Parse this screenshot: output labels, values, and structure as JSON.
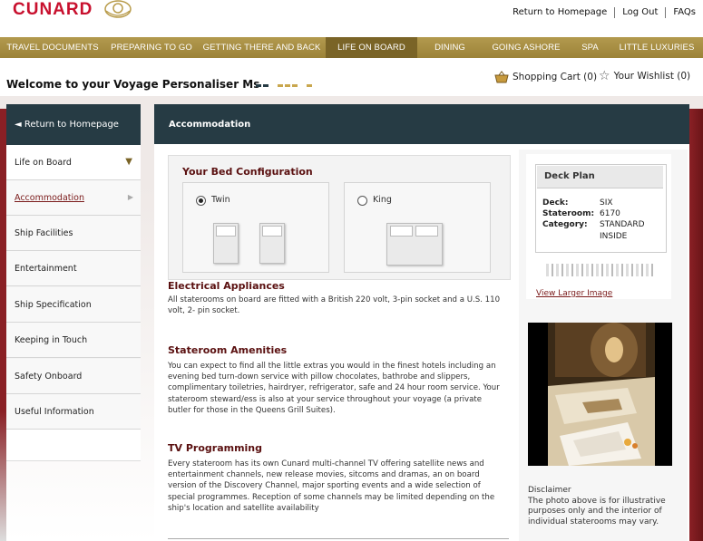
{
  "brand": {
    "name": "CUNARD"
  },
  "top_links": [
    "Return to Homepage",
    "Log Out",
    "FAQs"
  ],
  "nav": [
    {
      "label": "TRAVEL DOCUMENTS",
      "active": false
    },
    {
      "label": "PREPARING TO GO",
      "active": false
    },
    {
      "label": "GETTING THERE AND BACK",
      "active": false
    },
    {
      "label": "LIFE ON BOARD",
      "active": true
    },
    {
      "label": "DINING",
      "active": false
    },
    {
      "label": "GOING ASHORE",
      "active": false
    },
    {
      "label": "SPA",
      "active": false
    },
    {
      "label": "LITTLE LUXURIES",
      "active": false
    }
  ],
  "welcome": "Welcome to your Voyage Personaliser Ms",
  "header_actions": {
    "cart_label": "Shopping Cart (0)",
    "wishlist_label": "Your Wishlist (0)"
  },
  "sidebar": {
    "back_label": "◄ Return to Homepage",
    "section_label": "Life on Board",
    "items": [
      {
        "label": "Accommodation",
        "current": true
      },
      {
        "label": "Ship Facilities",
        "current": false
      },
      {
        "label": "Entertainment",
        "current": false
      },
      {
        "label": "Ship Specification",
        "current": false
      },
      {
        "label": "Keeping in Touch",
        "current": false
      },
      {
        "label": "Safety Onboard",
        "current": false
      },
      {
        "label": "Useful Information",
        "current": false
      }
    ]
  },
  "main": {
    "title": "Accommodation",
    "bed_config": {
      "title": "Your Bed Configuration",
      "options": [
        {
          "label": "Twin",
          "selected": true
        },
        {
          "label": "King",
          "selected": false
        }
      ]
    },
    "sections": [
      {
        "heading": "Electrical Appliances",
        "text": "All staterooms on board are fitted with a British 220 volt, 3-pin socket and a U.S. 110 volt, 2- pin socket."
      },
      {
        "heading": "Stateroom Amenities",
        "text": "You can expect to find all the little extras you would in the finest hotels including an evening bed turn-down service with pillow chocolates, bathrobe and slippers, complimentary toiletries, hairdryer, refrigerator, safe and 24 hour room service. Your stateroom steward/ess is also at your service throughout your voyage (a private butler for those in the Queens Grill Suites)."
      },
      {
        "heading": "TV Programming",
        "text": "Every stateroom has its own Cunard multi-channel TV offering satellite news and entertainment channels, new release movies, sitcoms and dramas, an on board version of the Discovery Channel, major sporting events and a wide selection of special programmes.  Reception of some channels may be limited depending on the ship's location and satellite availability"
      }
    ]
  },
  "deck_plan": {
    "title": "Deck Plan",
    "deck_label": "Deck:",
    "deck_value": "SIX",
    "stateroom_label": "Stateroom:",
    "stateroom_value": "6170",
    "category_label": "Category:",
    "category_value_1": "STANDARD",
    "category_value_2": "INSIDE",
    "view_link": "View Larger Image"
  },
  "disclaimer": {
    "title": "Disclaimer",
    "text": "The photo above is for illustrative purposes only and the interior of individual staterooms may vary."
  },
  "colors": {
    "nav_bg": "#a98f44",
    "nav_active": "#7a6427",
    "header_dark": "#263b44",
    "heading_red": "#5a1010",
    "brand_red": "#c8102e",
    "accent_red": "#8a2025"
  }
}
